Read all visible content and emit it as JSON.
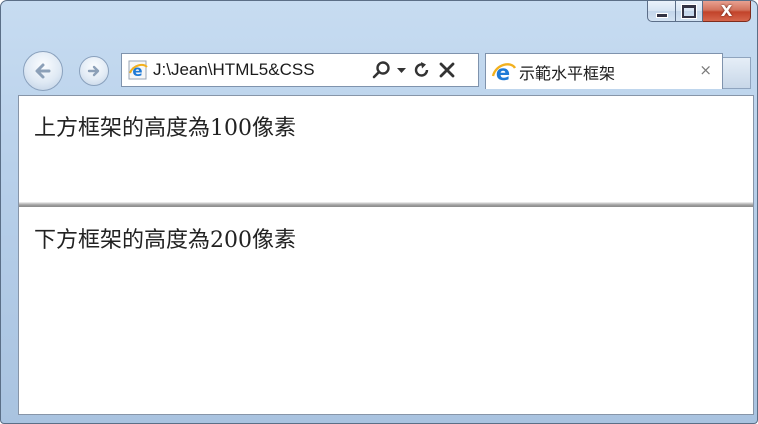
{
  "window": {
    "controls": {
      "minimize": "minimize",
      "maximize": "maximize",
      "close": "X"
    }
  },
  "toolbar": {
    "address": "J:\\Jean\\HTML5&CSS",
    "icons": [
      "back-arrow-icon",
      "forward-arrow-icon",
      "ie-page-icon",
      "search-icon",
      "dropdown-arrow-icon",
      "refresh-icon",
      "stop-icon"
    ]
  },
  "tab": {
    "title": "示範水平框架",
    "close": "×"
  },
  "frames": {
    "top_text": "上方框架的高度為100像素",
    "bottom_text": "下方框架的高度為200像素"
  },
  "colors": {
    "chrome": "#b8d0ea",
    "close_button": "#c2432a",
    "ie_logo": "#1f7ad6",
    "ie_swoosh": "#f2b01e"
  }
}
